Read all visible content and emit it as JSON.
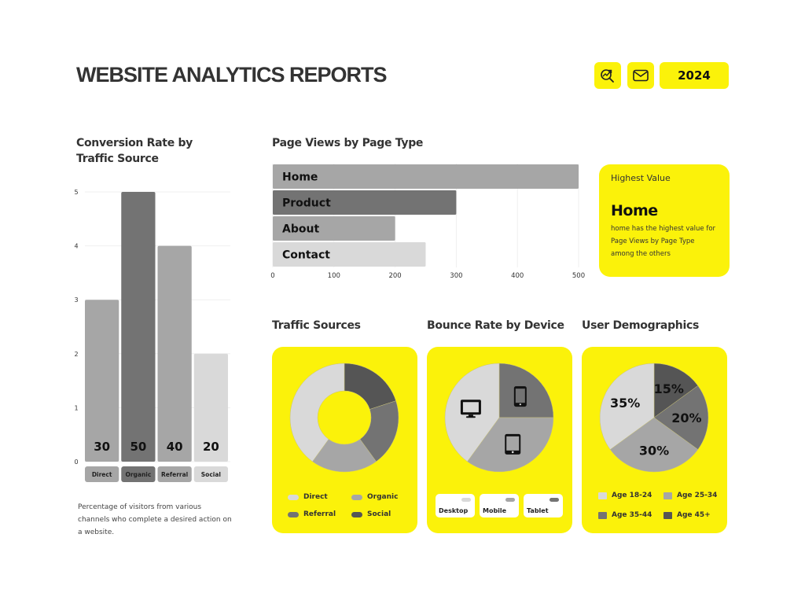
{
  "header": {
    "title": "WEBSITE ANALYTICS REPORTS",
    "search_icon": "search-chart-icon",
    "mail_icon": "mail-icon",
    "year": "2024",
    "accent": "#fbf20a"
  },
  "conversion": {
    "title_line1": "Conversion Rate by",
    "title_line2": "Traffic Source",
    "description": "Percentage of visitors from various channels who complete a desired action on a website."
  },
  "page_views": {
    "title": "Page Views by Page Type",
    "highest": {
      "label": "Highest Value",
      "value": "Home",
      "description": "home has the highest value for Page Views by Page Type among the others"
    }
  },
  "traffic_sources": {
    "title": "Traffic Sources"
  },
  "bounce_rate": {
    "title": "Bounce Rate by Device",
    "devices": [
      {
        "label": "Desktop",
        "icon": "desktop-icon",
        "color": "#d9d9d9"
      },
      {
        "label": "Mobile",
        "icon": "mobile-icon",
        "color": "#a6a6a6"
      },
      {
        "label": "Tablet",
        "icon": "tablet-icon",
        "color": "#737373"
      }
    ]
  },
  "demographics": {
    "title": "User Demographics"
  },
  "chart_data": [
    {
      "type": "bar",
      "title": "Conversion Rate by Traffic Source",
      "categories": [
        "Direct",
        "Organic",
        "Referral",
        "Social"
      ],
      "values": [
        3,
        5,
        4,
        2
      ],
      "data_labels": [
        "30",
        "50",
        "40",
        "20"
      ],
      "colors": [
        "#a6a6a6",
        "#737373",
        "#a6a6a6",
        "#d9d9d9"
      ],
      "yticks": [
        "0",
        "1",
        "2",
        "3",
        "4",
        "5"
      ],
      "ylim": [
        0,
        5
      ],
      "grid": true
    },
    {
      "type": "bar",
      "orientation": "horizontal",
      "title": "Page Views by Page Type",
      "categories": [
        "Home",
        "Product",
        "About",
        "Contact"
      ],
      "values": [
        500,
        300,
        200,
        250
      ],
      "colors": [
        "#a6a6a6",
        "#737373",
        "#a6a6a6",
        "#d9d9d9"
      ],
      "xticks": [
        "0",
        "100",
        "200",
        "300",
        "400",
        "500"
      ],
      "xlim": [
        0,
        500
      ],
      "grid": true
    },
    {
      "type": "pie",
      "variant": "donut",
      "title": "Traffic Sources",
      "slices": [
        {
          "label": "Social",
          "value": 20,
          "color": "#555555"
        },
        {
          "label": "Referral",
          "value": 20,
          "color": "#737373"
        },
        {
          "label": "Organic",
          "value": 20,
          "color": "#a6a6a6"
        },
        {
          "label": "Direct",
          "value": 40,
          "color": "#d9d9d9"
        }
      ],
      "legend": [
        {
          "label": "Direct",
          "color": "#d9d9d9"
        },
        {
          "label": "Organic",
          "color": "#a6a6a6"
        },
        {
          "label": "Referral",
          "color": "#737373"
        },
        {
          "label": "Social",
          "color": "#555555"
        }
      ],
      "legend_position": "bottom"
    },
    {
      "type": "pie",
      "title": "Bounce Rate by Device",
      "slices": [
        {
          "label": "Tablet",
          "value": 25,
          "color": "#737373",
          "icon": "mobile-icon"
        },
        {
          "label": "Mobile",
          "value": 35,
          "color": "#a6a6a6",
          "icon": "tablet-icon"
        },
        {
          "label": "Desktop",
          "value": 40,
          "color": "#d9d9d9",
          "icon": "desktop-icon"
        }
      ],
      "legend_position": "bottom"
    },
    {
      "type": "pie",
      "title": "User Demographics",
      "slices": [
        {
          "label": "Age 45+",
          "value": 15,
          "text": "15%",
          "color": "#555555"
        },
        {
          "label": "Age 35-44",
          "value": 20,
          "text": "20%",
          "color": "#737373"
        },
        {
          "label": "Age 25-34",
          "value": 30,
          "text": "30%",
          "color": "#a6a6a6"
        },
        {
          "label": "Age 18-24",
          "value": 35,
          "text": "35%",
          "color": "#d9d9d9"
        }
      ],
      "legend": [
        {
          "label": "Age 18-24",
          "color": "#d9d9d9"
        },
        {
          "label": "Age 25-34",
          "color": "#a6a6a6"
        },
        {
          "label": "Age 35-44",
          "color": "#737373"
        },
        {
          "label": "Age 45+",
          "color": "#555555"
        }
      ],
      "legend_position": "bottom"
    }
  ]
}
